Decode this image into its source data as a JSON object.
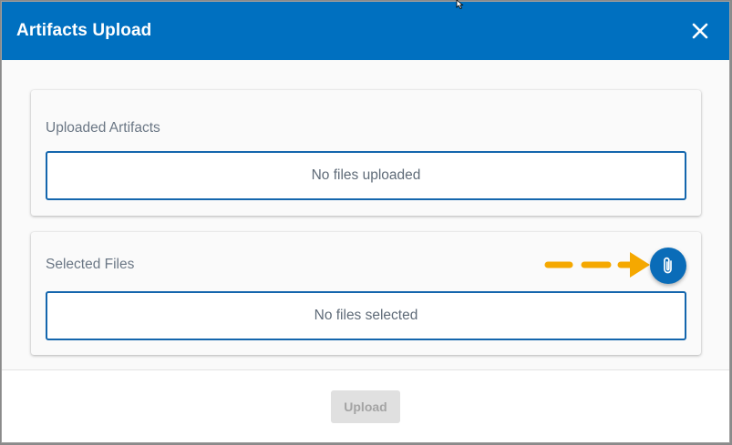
{
  "dialog": {
    "title": "Artifacts Upload",
    "close_icon": "close-icon"
  },
  "uploaded": {
    "label": "Uploaded Artifacts",
    "empty_text": "No files uploaded"
  },
  "selected": {
    "label": "Selected Files",
    "empty_text": "No files selected",
    "attach_icon": "paperclip-icon"
  },
  "footer": {
    "upload_label": "Upload",
    "upload_disabled": true
  },
  "colors": {
    "header": "#0070c0",
    "accent": "#0a6cb8",
    "annotation_arrow": "#f5a800",
    "disabled_button": "#e0e0e0"
  }
}
